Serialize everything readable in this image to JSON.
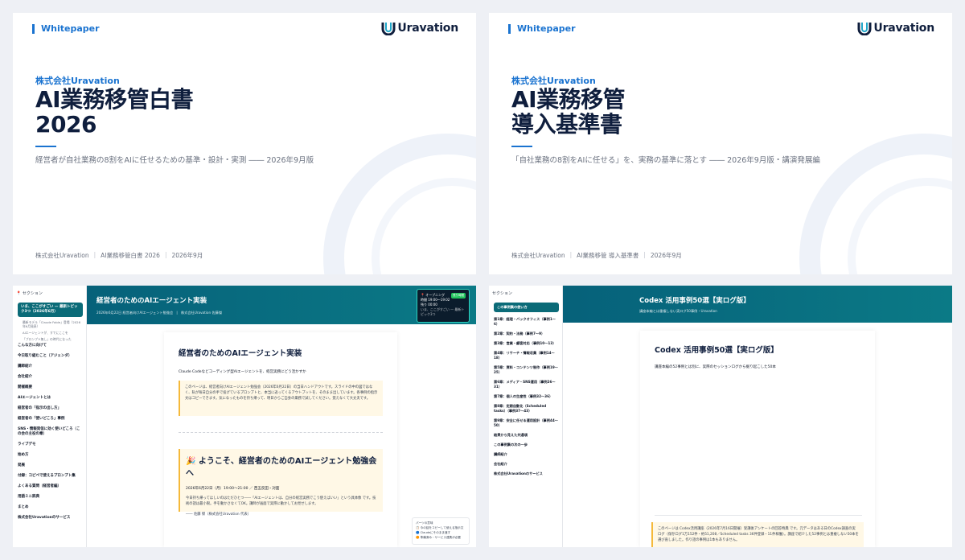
{
  "slide1": {
    "tag": "Whitepaper",
    "logo_text": "Uravation",
    "company": "株式会社Uravation",
    "title_line1": "AI業務移管白書",
    "title_line2": "2026",
    "subtitle": "経営者が自社業務の8割をAIに任せるための基準・設計・実測 ―― 2026年9月版",
    "footer": [
      "株式会社Uravation",
      "AI業務移管白書 2026",
      "2026年9月"
    ]
  },
  "slide2": {
    "tag": "Whitepaper",
    "logo_text": "Uravation",
    "company": "株式会社Uravation",
    "title_line1": "AI業務移管",
    "title_line2": "導入基準書",
    "subtitle": "「自社業務の8割をAIに任せる」を、実務の基準に落とす ―― 2026年9月版・講演発展編",
    "footer": [
      "株式会社Uravation",
      "AI業務移管 導入基準書",
      "2026年9月"
    ]
  },
  "doc1": {
    "sidebar_header": "セクション",
    "sidebar_active": "いま、ここがすごい — 最新トピック3つ（2026年6月）",
    "sidebar_sub": [
      "最新モデル「Claude Fable」登場（2026年6月発表）",
      "AIエージェントが、すでにここを",
      "「プロンプト無し」の時代になった"
    ],
    "sidebar_items": [
      "こんな方に向けて",
      "今日取り組むこと（アジェンダ）",
      "講師紹介",
      "会社紹介",
      "開催概要",
      "AIエージェントとは",
      "経営者の「指示の出し方」",
      "経営者の「使いどころ」事例",
      "SNS・情報発信に効く使いどころ（この会の主役の章）",
      "ライブデモ",
      "始め方",
      "発展",
      "付録：コピペで使えるプロンプト集",
      "よくある質問（経営者編）",
      "用語ミニ辞典",
      "まとめ",
      "株式会社Uravationのサービス"
    ],
    "banner_title": "経営者のためのAIエージェント実装",
    "banner_sub": "2026年6月22日 経営者向けAIエージェント勉強会　|　株式会社Uravation 佐藤傑",
    "popup_title": "オープニング",
    "popup_tag": "残り時間",
    "popup_line1": "時間 19:00〜19:02",
    "popup_line2": "残り 00:00",
    "popup_line3": "いま、ここがすごい — 最新トピック3つ",
    "card_title": "経営者のためのAIエージェント実装",
    "card_subtitle": "Claude Codeなどコーディング型AIエージェントを、経営実務にどう活かすか",
    "note": "このページは、経営者向けAIエージェント勉強会（2026年6月22日）の当日ハンドアウトです。スライドの中の図ではなく、私が毎日自分の手で投げているプロンプトと、本当に返ってくるアウトプットを、そのまま出しています。各事例の指示文はコピーできます。気になったものを持ち帰って、明日からご自身の業務で試してください。覚えなくて大丈夫です。",
    "welcome_title": "🎉 ようこそ、経営者のためのAIエージェント勉強会へ",
    "welcome_date": "2026年6月22日（月）19:00〜21:00 ／ 西五反田・対面",
    "welcome_body": "今日持ち帰ってほしいのはただひとつ――「AIエージェントは、自分の経営実務でこう使えばいい」という具体像 です。技術の話は最小限。手を動かさなくてOK。講師が画面で実際に動かしてお見せします。",
    "welcome_sign": "―― 佐藤 傑（株式会社Uravation 代表）",
    "legend": [
      "パーツの意味",
      "今の話をコピーして使える指示文",
      "Claudeにそのまま渡す",
      "準備済み・サービス連携が必要"
    ]
  },
  "doc2": {
    "sidebar_header": "セクション",
    "sidebar_active": "この事例集の使い方",
    "sidebar_items": [
      "第1章：経理・バックオフィス（事例1〜6）",
      "第2章：契約・法務（事例7〜9）",
      "第3章：営業・顧客対応（事例10〜13）",
      "第4章：リサーチ・情報収集（事例14〜18）",
      "第5章：資料・コンテンツ制作（事例19〜25）",
      "第6章：メディア・SNS運用（事例26〜31）",
      "第7章：個人の生産性（事例32〜36）",
      "第8章：定期自動化（Scheduled tasks）（事例37〜43）",
      "第9章：安全に任せる運用設計（事例44〜50）",
      "結果から見えた共通項",
      "この事例集の次の一歩",
      "講師紹介",
      "会社紹介",
      "株式会社Uravationのサービス"
    ],
    "banner_title": "Codex 活用事例50選【実ログ版】",
    "banner_sub": "講座本編とは重複しない実ログ50事例・Uravation",
    "card_title": "Codex 活用事例50選【実ログ版】",
    "card_subtitle": "講座本編の52事例とは別に、実際のセッションログから掘り起こした50本",
    "note": "このページは Codex活用講座（2026年7月16日開催）受講後アンケートの回答特典 です。元データはある日のCodex調査の実ログ（保存ログ1万152件・約51,208／Scheduled tasks 36件登録・11件稼働）。講座で紹介した52事例とは重複しない50本を選び直しました。作り話の事例は1本もありません。"
  },
  "colors": {
    "accent": "#1a73d0",
    "navy": "#0f1e3d",
    "teal": "#0b6b78",
    "note_bg": "#fff8e6",
    "note_border": "#f5b93a"
  }
}
